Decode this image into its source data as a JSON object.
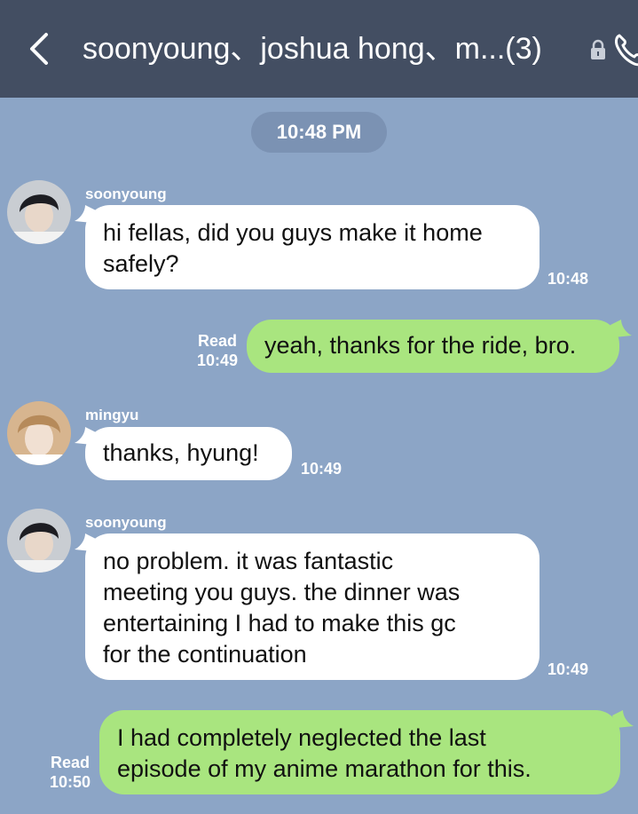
{
  "header": {
    "title": "soonyoung、joshua hong、m...(3)",
    "back_icon": "chevron-left-icon",
    "lock_icon": "lock-icon",
    "call_icon": "phone-icon"
  },
  "timestamp_divider": "10:48 PM",
  "messages": [
    {
      "sender": "soonyoung",
      "text_lines": [
        "hi fellas, did you guys make it home",
        "safely?"
      ],
      "time": "10:48"
    },
    {
      "outgoing": true,
      "read_label": "Read",
      "time": "10:49",
      "text_lines": [
        "yeah, thanks for the ride, bro."
      ]
    },
    {
      "sender": "mingyu",
      "text_lines": [
        "thanks, hyung!"
      ],
      "time": "10:49"
    },
    {
      "sender": "soonyoung",
      "text_lines": [
        "no problem. it was fantastic",
        "meeting you guys. the dinner was",
        "entertaining I had to make this gc",
        "for the continuation"
      ],
      "time": "10:49"
    },
    {
      "outgoing": true,
      "read_label": "Read",
      "time": "10:50",
      "text_lines": [
        "I had completely neglected the last",
        "episode of my anime marathon for this."
      ]
    }
  ],
  "colors": {
    "header_bg": "#434e62",
    "chat_bg": "#8ca5c6",
    "incoming_bubble": "#ffffff",
    "outgoing_bubble": "#a9e57f"
  }
}
